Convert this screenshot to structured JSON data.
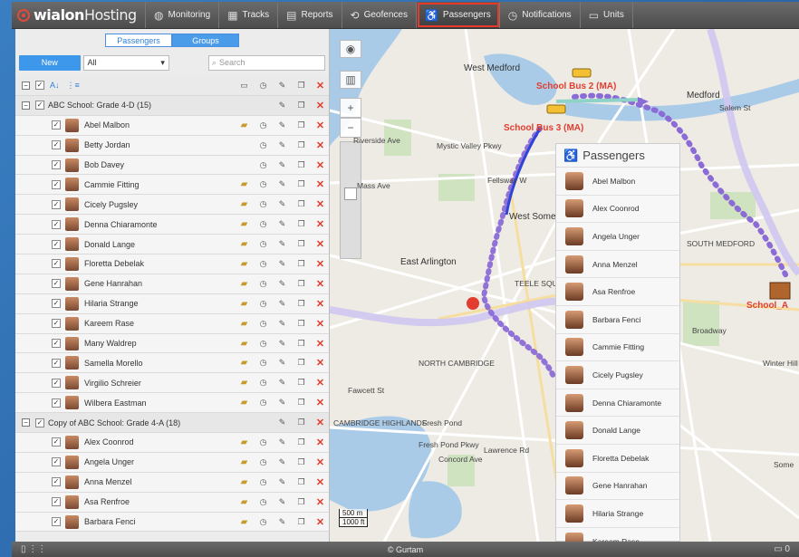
{
  "app": {
    "logo_brand": "wialon",
    "logo_suffix": "Hosting",
    "footer": "© Gurtam"
  },
  "nav": [
    {
      "label": "Monitoring",
      "icon": "globe-icon",
      "active": false
    },
    {
      "label": "Tracks",
      "icon": "tracks-icon",
      "active": false
    },
    {
      "label": "Reports",
      "icon": "reports-icon",
      "active": false
    },
    {
      "label": "Geofences",
      "icon": "geofence-icon",
      "active": false
    },
    {
      "label": "Passengers",
      "icon": "passenger-icon",
      "active": true
    },
    {
      "label": "Notifications",
      "icon": "clock-icon",
      "active": false
    },
    {
      "label": "Units",
      "icon": "car-icon",
      "active": false
    }
  ],
  "panel": {
    "tabs": [
      "Passengers",
      "Groups"
    ],
    "new_label": "New",
    "filter_value": "All",
    "search_placeholder": "Search"
  },
  "list": [
    {
      "type": "group",
      "name": "ABC School: Grade 4-D (15)"
    },
    {
      "type": "item",
      "name": "Abel Malbon",
      "bus": true
    },
    {
      "type": "item",
      "name": "Betty Jordan",
      "bus": false
    },
    {
      "type": "item",
      "name": "Bob Davey",
      "bus": false
    },
    {
      "type": "item",
      "name": "Cammie Fitting",
      "bus": true
    },
    {
      "type": "item",
      "name": "Cicely Pugsley",
      "bus": true
    },
    {
      "type": "item",
      "name": "Denna Chiaramonte",
      "bus": true
    },
    {
      "type": "item",
      "name": "Donald Lange",
      "bus": true
    },
    {
      "type": "item",
      "name": "Floretta Debelak",
      "bus": true
    },
    {
      "type": "item",
      "name": "Gene Hanrahan",
      "bus": true
    },
    {
      "type": "item",
      "name": "Hilaria Strange",
      "bus": true
    },
    {
      "type": "item",
      "name": "Kareem Rase",
      "bus": true
    },
    {
      "type": "item",
      "name": "Many Waldrep",
      "bus": true
    },
    {
      "type": "item",
      "name": "Samella Morello",
      "bus": true
    },
    {
      "type": "item",
      "name": "Virgilio Schreier",
      "bus": true
    },
    {
      "type": "item",
      "name": "Wilbera Eastman",
      "bus": true
    },
    {
      "type": "group",
      "name": "Copy of ABC School: Grade 4-A (18)"
    },
    {
      "type": "item",
      "name": "Alex Coonrod",
      "bus": true
    },
    {
      "type": "item",
      "name": "Angela Unger",
      "bus": true
    },
    {
      "type": "item",
      "name": "Anna Menzel",
      "bus": true
    },
    {
      "type": "item",
      "name": "Asa Renfroe",
      "bus": true
    },
    {
      "type": "item",
      "name": "Barbara Fenci",
      "bus": true
    }
  ],
  "map": {
    "place_labels": [
      {
        "text": "West Medford"
      },
      {
        "text": "Medford"
      },
      {
        "text": "West Somerville"
      },
      {
        "text": "East Arlington"
      },
      {
        "text": "SOUTH MEDFORD"
      },
      {
        "text": "Winter Hill"
      },
      {
        "text": "NORTH CAMBRIDGE"
      },
      {
        "text": "Fresh Pond"
      },
      {
        "text": "CAMBRIDGE HIGHLANDS"
      },
      {
        "text": "TEELE SQUARE"
      },
      {
        "text": "Mystic Valley Pkwy"
      },
      {
        "text": "Mass Ave"
      },
      {
        "text": "Fellsway W"
      },
      {
        "text": "Riverside Ave"
      },
      {
        "text": "Broadway"
      },
      {
        "text": "Fawcett St"
      },
      {
        "text": "Fresh Pond Pkwy"
      },
      {
        "text": "Concord Ave"
      },
      {
        "text": "Lawrence Rd"
      },
      {
        "text": "Salem St"
      },
      {
        "text": "Some"
      }
    ],
    "unit_labels": [
      "School Bus 2 (MA)",
      "School Bus 3 (MA)",
      "School_A"
    ],
    "scale_m": "500 m",
    "scale_ft": "1000 ft",
    "passengers_title": "Passengers",
    "passengers": [
      "Abel Malbon",
      "Alex Coonrod",
      "Angela Unger",
      "Anna Menzel",
      "Asa Renfroe",
      "Barbara Fenci",
      "Cammie Fitting",
      "Cicely Pugsley",
      "Denna Chiaramonte",
      "Donald Lange",
      "Floretta Debelak",
      "Gene Hanrahan",
      "Hilaria Strange",
      "Kareem Rase"
    ]
  }
}
